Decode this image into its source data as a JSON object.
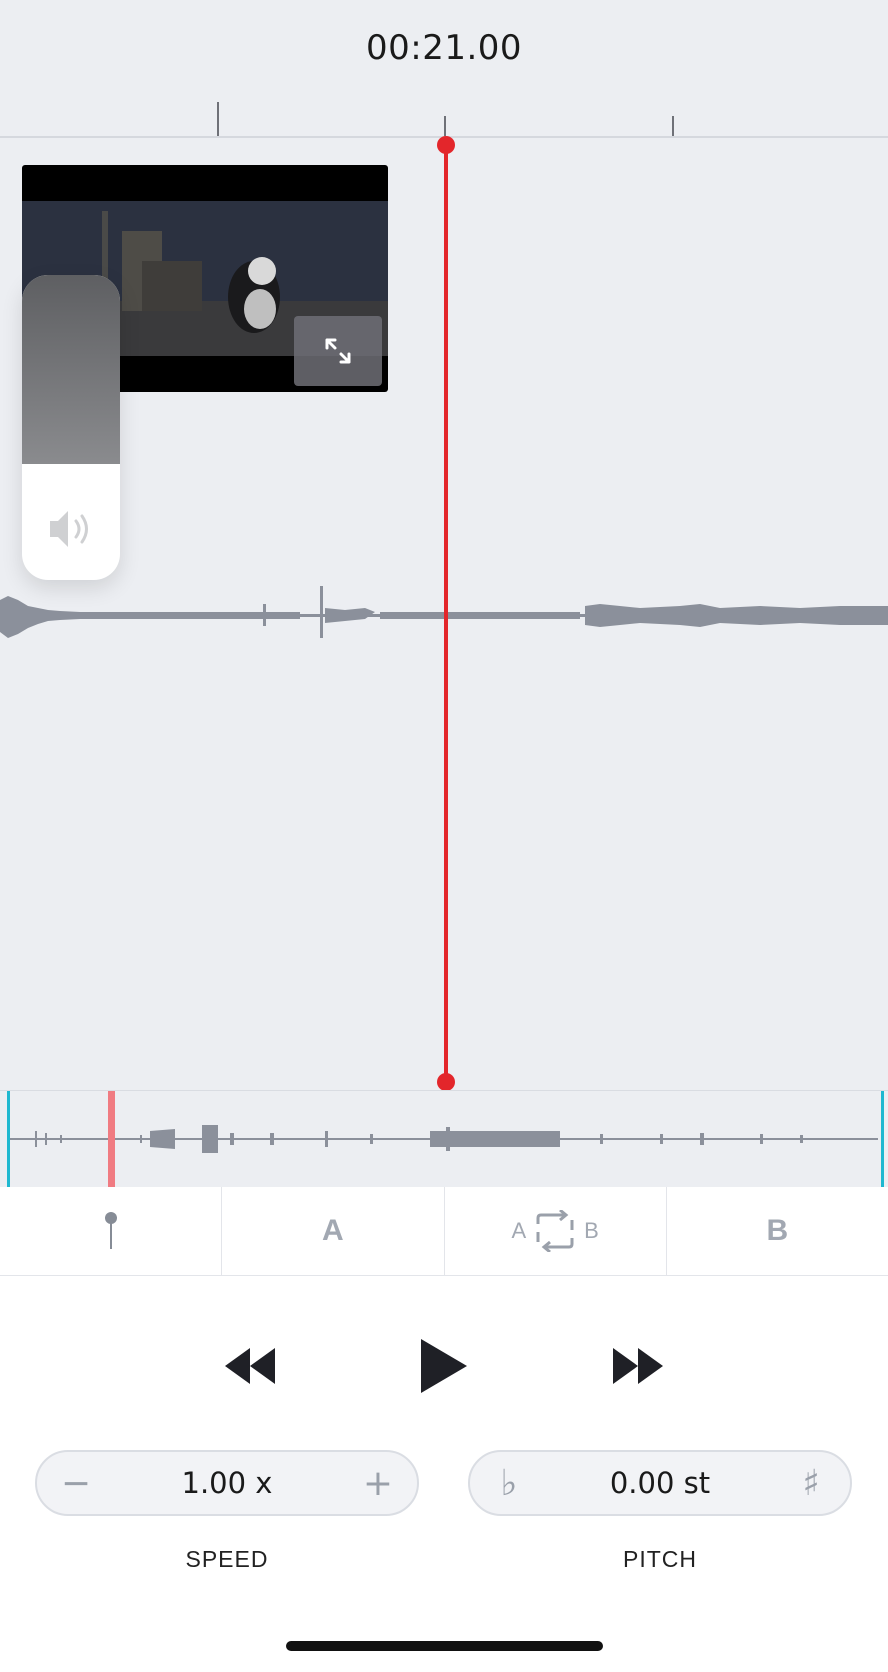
{
  "timeline": {
    "current_time": "00:21.00"
  },
  "video": {
    "expand_label": "expand"
  },
  "volume": {
    "level": 0.62
  },
  "loop_toolbar": {
    "marker_label": "",
    "a_label": "A",
    "ab_left": "A",
    "ab_right": "B",
    "b_label": "B"
  },
  "transport": {
    "rewind_icon": "rewind-icon",
    "play_icon": "play-icon",
    "forward_icon": "fast-forward-icon"
  },
  "speed": {
    "minus": "−",
    "value": "1.00 x",
    "plus": "+",
    "label": "SPEED"
  },
  "pitch": {
    "flat": "♭",
    "value": "0.00 st",
    "sharp": "♯",
    "label": "PITCH"
  },
  "colors": {
    "playhead": "#e3262b",
    "loop_marker": "#1fb8d0",
    "overview_position": "#f07b82",
    "waveform": "#8b909b"
  }
}
